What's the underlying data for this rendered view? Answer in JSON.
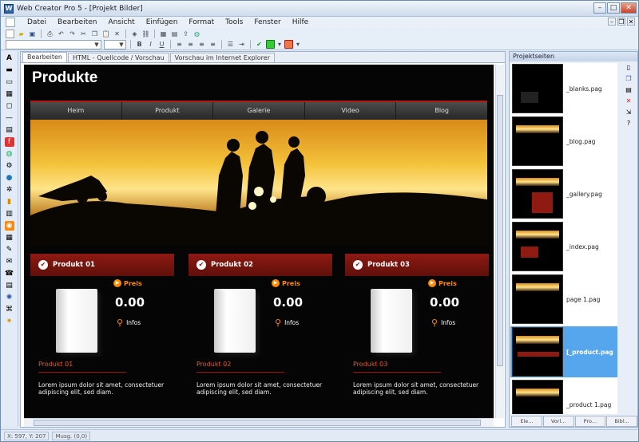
{
  "window": {
    "title": "Web Creator Pro 5 - [Projekt Bilder]"
  },
  "menu": [
    "Datei",
    "Bearbeiten",
    "Ansicht",
    "Einfügen",
    "Format",
    "Tools",
    "Fenster",
    "Hilfe"
  ],
  "editor": {
    "tabs": [
      "Bearbeiten",
      "HTML - Quellcode / Vorschau",
      "Vorschau im Internet Explorer"
    ],
    "site_title": "Produkte",
    "nav": [
      "Heim",
      "Produkt",
      "Galerie",
      "Video",
      "Blog"
    ],
    "products": [
      {
        "title": "Produkt 01",
        "price_label": "Preis",
        "price": "0.00",
        "infos_label": "Infos",
        "name": "Produkt 01",
        "desc": "Lorem ipsum dolor sit amet, consectetuer adipiscing elit, sed diam."
      },
      {
        "title": "Produkt 02",
        "price_label": "Preis",
        "price": "0.00",
        "infos_label": "Infos",
        "name": "Produkt 02",
        "desc": "Lorem ipsum dolor sit amet, consectetuer adipiscing elit, sed diam."
      },
      {
        "title": "Produkt 03",
        "price_label": "Preis",
        "price": "0.00",
        "infos_label": "Infos",
        "name": "Produkt 03",
        "desc": "Lorem ipsum dolor sit amet, consectetuer adipiscing elit, sed diam."
      }
    ]
  },
  "panel": {
    "title": "Projektseiten",
    "pages": [
      {
        "label": "_blanks.pag",
        "selected": false
      },
      {
        "label": "_blog.pag",
        "selected": false
      },
      {
        "label": "_gallery.pag",
        "selected": false
      },
      {
        "label": "_index.pag",
        "selected": false
      },
      {
        "label": "page 1.pag",
        "selected": false
      },
      {
        "label": "[_product.pag",
        "selected": true
      },
      {
        "label": "_product 1.pag",
        "selected": false
      }
    ],
    "tabs": [
      "Ele...",
      "Vorl...",
      "Pro...",
      "Bibl..."
    ]
  },
  "status": {
    "pos": "X: 597, Y: 207",
    "extra": "Musg. (0,0)"
  },
  "colors": {
    "accent_red": "#8e1a12",
    "orange": "#ff8a00",
    "selection": "#56a6ee"
  }
}
